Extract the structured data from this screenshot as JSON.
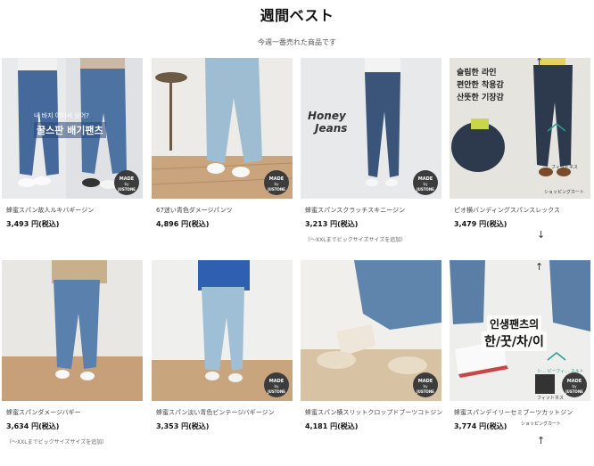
{
  "header": {
    "title": "週間ベスト",
    "subtitle": "今週一番売れた商品です"
  },
  "badge": {
    "line1": "MADE",
    "line2": "by",
    "line3": "JUSTONE"
  },
  "products": [
    {
      "name": "蜂蜜スパン故人ルキバギージン",
      "price": "3,493 円(税込)",
      "overlay_top": "내 바지 어디서 샀어?",
      "overlay_main": "꿀스판 배기팬츠"
    },
    {
      "name": "67迷い青色ダメージパンツ",
      "price": "4,896 円(税込)"
    },
    {
      "name": "蜂蜜スパンスクラッチスキニージン",
      "price": "3,213 円(税込)",
      "note": "（〜XXLまでビックサイズサイズを追加）",
      "overlay_logo_1": "Honey",
      "overlay_logo_2": "Jeans"
    },
    {
      "name": "ピオ横バンディングスパンスレックス",
      "price": "3,479 円(税込)",
      "overlay_lines": [
        "슬림한 라인",
        "편안한 착용감",
        "산뜻한 기장감"
      ],
      "fitness_label": "フィットネス",
      "cart_label": "ショッピングカート",
      "arrow_up": "↑",
      "arrow_down": "↓"
    },
    {
      "name": "蜂蜜スパンダメージバギー",
      "price": "3,634 円(税込)",
      "note": "（〜XXLまでビックサイズサイズを追加）"
    },
    {
      "name": "蜂蜜スパン淡い青色ビンテージバギージン",
      "price": "3,353 円(税込)"
    },
    {
      "name": "蜂蜜スパン横スリットクロップドブーツコトジン",
      "price": "4,181 円(税込)"
    },
    {
      "name": "蜂蜜スパンデイリーセミブーツカットジン",
      "price": "3,774 円(税込)",
      "overlay_line1": "인생팬츠의",
      "overlay_line2": "한/꿋/차/이",
      "fitness_label": "フィットネス",
      "fitness_label2": "シ… ピーフィ… スルト",
      "cart_label": "ショッピングカート",
      "arrow_up": "↑"
    }
  ],
  "colors": {
    "denim_mid": "#4a6e9a",
    "denim_light": "#8fb0c8",
    "accent_teal": "#2a9d8f",
    "badge_bg": "#3c3c3c"
  }
}
